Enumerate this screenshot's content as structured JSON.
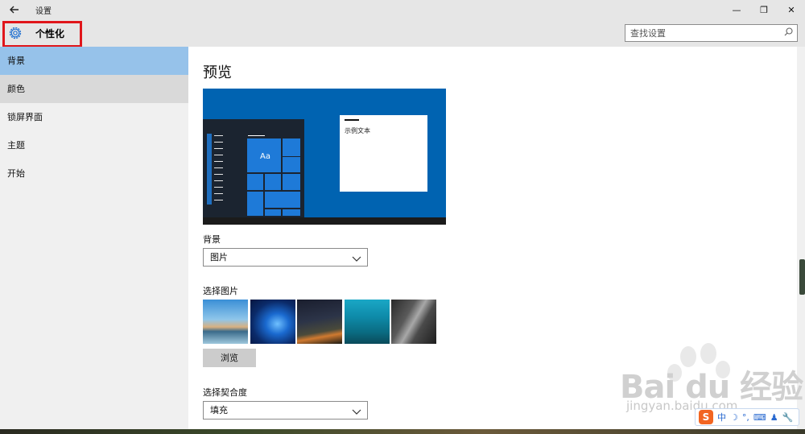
{
  "window": {
    "title": "设置",
    "back_icon": "back-arrow-icon",
    "controls": {
      "minimize": "—",
      "restore": "❐",
      "close": "✕"
    }
  },
  "header": {
    "title": "个性化",
    "icon": "gear-icon",
    "search_placeholder": "查找设置",
    "accent_color": "#e0161b"
  },
  "sidebar": {
    "items": [
      {
        "label": "背景",
        "state": "selected"
      },
      {
        "label": "颜色",
        "state": "hover"
      },
      {
        "label": "锁屏界面",
        "state": "normal"
      },
      {
        "label": "主题",
        "state": "normal"
      },
      {
        "label": "开始",
        "state": "normal"
      }
    ],
    "selected_color": "#96c2ea"
  },
  "main": {
    "preview_title": "预览",
    "preview": {
      "sample_text": "示例文本",
      "tile_text": "Aa",
      "background_color": "#0063b1"
    },
    "background_label": "背景",
    "background_value": "图片",
    "choose_picture_label": "选择图片",
    "browse_button": "浏览",
    "fit_label": "选择契合度",
    "fit_value": "填充"
  },
  "watermark": {
    "text": "Bai du 经验",
    "url": "jingyan.baidu.com"
  },
  "ime": {
    "logo": "S",
    "mode": "中",
    "icons": [
      "moon-icon",
      "punctuation-icon",
      "keyboard-icon",
      "user-icon",
      "wrench-icon"
    ]
  }
}
